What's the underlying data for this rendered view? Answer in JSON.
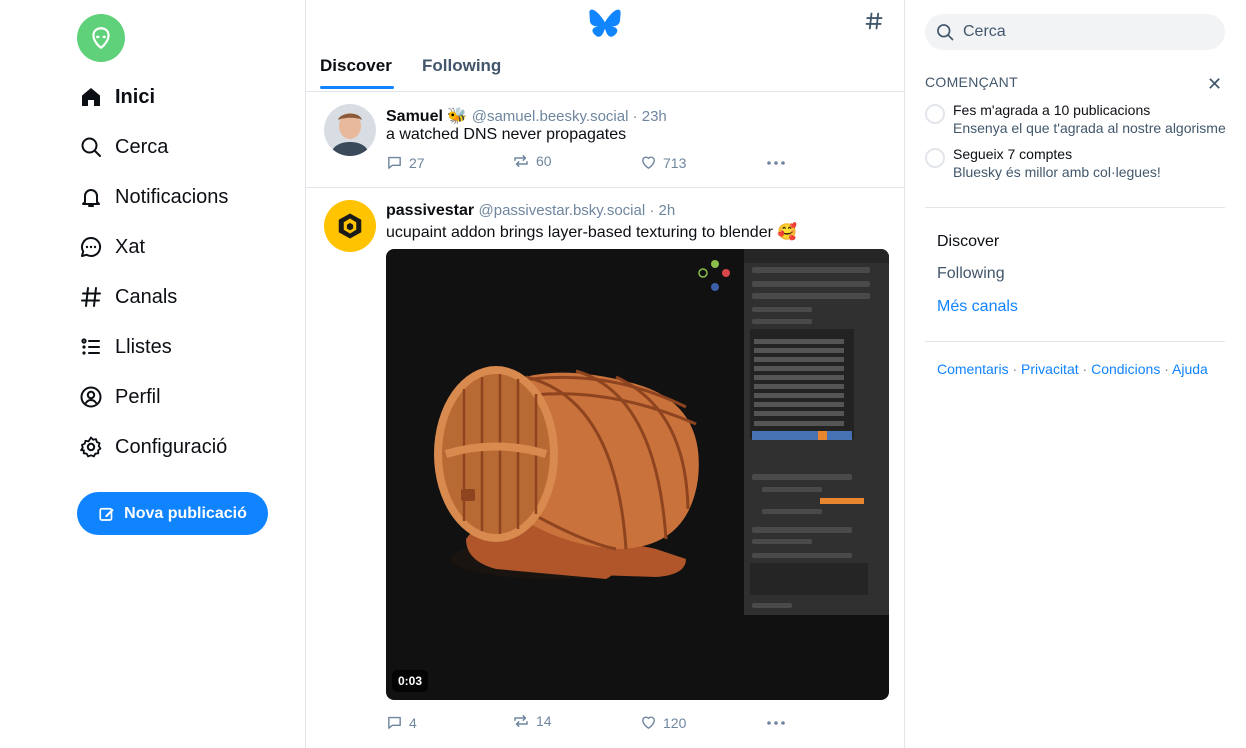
{
  "colors": {
    "accent": "#1083fe",
    "text": "#0b0f14",
    "muted": "#6f869f",
    "avatar_me": "#5fd17a"
  },
  "nav": {
    "items": [
      {
        "label": "Inici",
        "icon": "home-icon"
      },
      {
        "label": "Cerca",
        "icon": "search-icon"
      },
      {
        "label": "Notificacions",
        "icon": "bell-icon"
      },
      {
        "label": "Xat",
        "icon": "chat-icon"
      },
      {
        "label": "Canals",
        "icon": "hash-icon"
      },
      {
        "label": "Llistes",
        "icon": "list-icon"
      },
      {
        "label": "Perfil",
        "icon": "user-icon"
      },
      {
        "label": "Configuració",
        "icon": "gear-icon"
      }
    ],
    "compose_label": "Nova publicació"
  },
  "header": {
    "tabs": [
      "Discover",
      "Following"
    ]
  },
  "posts": [
    {
      "name": "Samuel 🐝",
      "handle": "@samuel.beesky.social · 23h",
      "text": "a watched DNS never propagates",
      "replies": "27",
      "reposts": "60",
      "likes": "713"
    },
    {
      "name": "passivestar",
      "handle": "@passivestar.bsky.social · 2h",
      "text": "ucupaint addon brings layer-based texturing to blender 🥰",
      "video_time": "0:03",
      "replies": "4",
      "reposts": "14",
      "likes": "120"
    }
  ],
  "sidebar": {
    "search_placeholder": "Cerca",
    "getting_started": "COMENÇANT",
    "tasks": [
      {
        "title": "Fes m'agrada a 10 publicacions",
        "desc": "Ensenya el que t'agrada al nostre algorisme"
      },
      {
        "title": "Segueix 7 comptes",
        "desc": "Bluesky és millor amb col·legues!"
      }
    ],
    "feeds": [
      "Discover",
      "Following",
      "Més canals"
    ],
    "footer": [
      "Comentaris",
      "Privacitat",
      "Condicions",
      "Ajuda"
    ]
  }
}
